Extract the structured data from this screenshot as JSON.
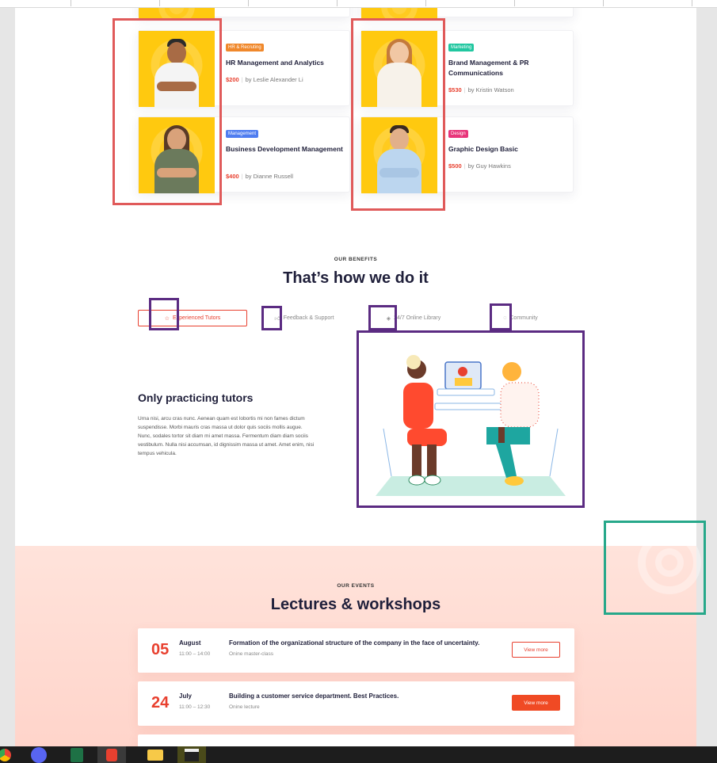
{
  "courses": [
    {
      "tag": "HR & Recruting",
      "tag_color": "#f0882b",
      "title": "HR  Management and Analytics",
      "price": "$200",
      "author": "by Leslie Alexander Li"
    },
    {
      "tag": "Marketing",
      "tag_color": "#21c7a0",
      "title": "Brand Management & PR Communications",
      "price": "$530",
      "author": "by Kristin Watson"
    },
    {
      "tag": "Management",
      "tag_color": "#4f7df0",
      "title": "Business Development Management",
      "price": "$400",
      "author": "by Dianne Russell"
    },
    {
      "tag": "Design",
      "tag_color": "#e8357a",
      "title": "Graphic Design Basic",
      "price": "$500",
      "author": "by Guy Hawkins"
    }
  ],
  "benefits": {
    "kicker": "OUR BENEFITS",
    "heading": "That’s how we do it",
    "tabs": [
      {
        "label": "Experienced Tutors",
        "icon": "star-icon"
      },
      {
        "label": "Feedback & Support",
        "icon": "thumbs-up-icon"
      },
      {
        "label": "24/7 Online Library",
        "icon": "layers-icon"
      },
      {
        "label": "Community",
        "icon": "chat-icon"
      }
    ],
    "panel_title": "Only practicing tutors",
    "panel_body": "Urna nisi, arcu cras nunc. Aenean quam est lobortis mi non fames dictum suspendisse. Morbi mauris cras massa ut dolor quis sociis mollis augue. Nunc, sodales tortor sit diam mi amet massa. Fermentum diam diam sociis vestibulum. Nulla nisi accumsan, id dignissim massa ut amet. Amet enim, nisi tempus vehicula."
  },
  "events": {
    "kicker": "OUR EVENTS",
    "heading": "Lectures & workshops",
    "items": [
      {
        "day": "05",
        "month": "August",
        "time": "11:00 – 14:00",
        "title": "Formation of the organizational structure of the company in the face of uncertainty.",
        "type": "Onine master-class",
        "button": "View more"
      },
      {
        "day": "24",
        "month": "July",
        "time": "11:00 – 12:30",
        "title": "Building a customer service department. Best Practices.",
        "type": "Onine lecture",
        "button": "View more"
      }
    ]
  },
  "colors": {
    "accent": "#e8402f",
    "highlight_red": "#e05a5a",
    "highlight_purple": "#5b2b82",
    "highlight_green": "#27a88a"
  },
  "taskbar": [
    "chrome-icon",
    "discord-icon",
    "excel-icon",
    "app-icon",
    "file-explorer-icon",
    "clapper-icon"
  ]
}
